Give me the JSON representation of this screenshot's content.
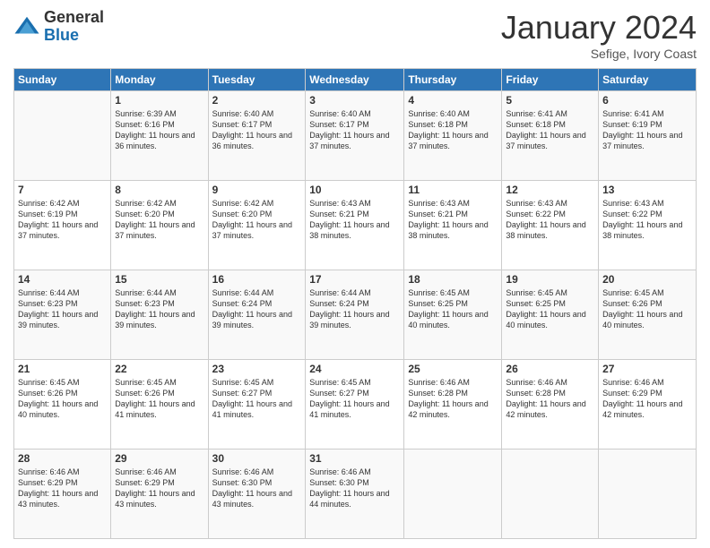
{
  "header": {
    "logo_general": "General",
    "logo_blue": "Blue",
    "month_title": "January 2024",
    "subtitle": "Sefige, Ivory Coast"
  },
  "columns": [
    "Sunday",
    "Monday",
    "Tuesday",
    "Wednesday",
    "Thursday",
    "Friday",
    "Saturday"
  ],
  "weeks": [
    [
      {
        "day": "",
        "sunrise": "",
        "sunset": "",
        "daylight": ""
      },
      {
        "day": "1",
        "sunrise": "Sunrise: 6:39 AM",
        "sunset": "Sunset: 6:16 PM",
        "daylight": "Daylight: 11 hours and 36 minutes."
      },
      {
        "day": "2",
        "sunrise": "Sunrise: 6:40 AM",
        "sunset": "Sunset: 6:17 PM",
        "daylight": "Daylight: 11 hours and 36 minutes."
      },
      {
        "day": "3",
        "sunrise": "Sunrise: 6:40 AM",
        "sunset": "Sunset: 6:17 PM",
        "daylight": "Daylight: 11 hours and 37 minutes."
      },
      {
        "day": "4",
        "sunrise": "Sunrise: 6:40 AM",
        "sunset": "Sunset: 6:18 PM",
        "daylight": "Daylight: 11 hours and 37 minutes."
      },
      {
        "day": "5",
        "sunrise": "Sunrise: 6:41 AM",
        "sunset": "Sunset: 6:18 PM",
        "daylight": "Daylight: 11 hours and 37 minutes."
      },
      {
        "day": "6",
        "sunrise": "Sunrise: 6:41 AM",
        "sunset": "Sunset: 6:19 PM",
        "daylight": "Daylight: 11 hours and 37 minutes."
      }
    ],
    [
      {
        "day": "7",
        "sunrise": "Sunrise: 6:42 AM",
        "sunset": "Sunset: 6:19 PM",
        "daylight": "Daylight: 11 hours and 37 minutes."
      },
      {
        "day": "8",
        "sunrise": "Sunrise: 6:42 AM",
        "sunset": "Sunset: 6:20 PM",
        "daylight": "Daylight: 11 hours and 37 minutes."
      },
      {
        "day": "9",
        "sunrise": "Sunrise: 6:42 AM",
        "sunset": "Sunset: 6:20 PM",
        "daylight": "Daylight: 11 hours and 37 minutes."
      },
      {
        "day": "10",
        "sunrise": "Sunrise: 6:43 AM",
        "sunset": "Sunset: 6:21 PM",
        "daylight": "Daylight: 11 hours and 38 minutes."
      },
      {
        "day": "11",
        "sunrise": "Sunrise: 6:43 AM",
        "sunset": "Sunset: 6:21 PM",
        "daylight": "Daylight: 11 hours and 38 minutes."
      },
      {
        "day": "12",
        "sunrise": "Sunrise: 6:43 AM",
        "sunset": "Sunset: 6:22 PM",
        "daylight": "Daylight: 11 hours and 38 minutes."
      },
      {
        "day": "13",
        "sunrise": "Sunrise: 6:43 AM",
        "sunset": "Sunset: 6:22 PM",
        "daylight": "Daylight: 11 hours and 38 minutes."
      }
    ],
    [
      {
        "day": "14",
        "sunrise": "Sunrise: 6:44 AM",
        "sunset": "Sunset: 6:23 PM",
        "daylight": "Daylight: 11 hours and 39 minutes."
      },
      {
        "day": "15",
        "sunrise": "Sunrise: 6:44 AM",
        "sunset": "Sunset: 6:23 PM",
        "daylight": "Daylight: 11 hours and 39 minutes."
      },
      {
        "day": "16",
        "sunrise": "Sunrise: 6:44 AM",
        "sunset": "Sunset: 6:24 PM",
        "daylight": "Daylight: 11 hours and 39 minutes."
      },
      {
        "day": "17",
        "sunrise": "Sunrise: 6:44 AM",
        "sunset": "Sunset: 6:24 PM",
        "daylight": "Daylight: 11 hours and 39 minutes."
      },
      {
        "day": "18",
        "sunrise": "Sunrise: 6:45 AM",
        "sunset": "Sunset: 6:25 PM",
        "daylight": "Daylight: 11 hours and 40 minutes."
      },
      {
        "day": "19",
        "sunrise": "Sunrise: 6:45 AM",
        "sunset": "Sunset: 6:25 PM",
        "daylight": "Daylight: 11 hours and 40 minutes."
      },
      {
        "day": "20",
        "sunrise": "Sunrise: 6:45 AM",
        "sunset": "Sunset: 6:26 PM",
        "daylight": "Daylight: 11 hours and 40 minutes."
      }
    ],
    [
      {
        "day": "21",
        "sunrise": "Sunrise: 6:45 AM",
        "sunset": "Sunset: 6:26 PM",
        "daylight": "Daylight: 11 hours and 40 minutes."
      },
      {
        "day": "22",
        "sunrise": "Sunrise: 6:45 AM",
        "sunset": "Sunset: 6:26 PM",
        "daylight": "Daylight: 11 hours and 41 minutes."
      },
      {
        "day": "23",
        "sunrise": "Sunrise: 6:45 AM",
        "sunset": "Sunset: 6:27 PM",
        "daylight": "Daylight: 11 hours and 41 minutes."
      },
      {
        "day": "24",
        "sunrise": "Sunrise: 6:45 AM",
        "sunset": "Sunset: 6:27 PM",
        "daylight": "Daylight: 11 hours and 41 minutes."
      },
      {
        "day": "25",
        "sunrise": "Sunrise: 6:46 AM",
        "sunset": "Sunset: 6:28 PM",
        "daylight": "Daylight: 11 hours and 42 minutes."
      },
      {
        "day": "26",
        "sunrise": "Sunrise: 6:46 AM",
        "sunset": "Sunset: 6:28 PM",
        "daylight": "Daylight: 11 hours and 42 minutes."
      },
      {
        "day": "27",
        "sunrise": "Sunrise: 6:46 AM",
        "sunset": "Sunset: 6:29 PM",
        "daylight": "Daylight: 11 hours and 42 minutes."
      }
    ],
    [
      {
        "day": "28",
        "sunrise": "Sunrise: 6:46 AM",
        "sunset": "Sunset: 6:29 PM",
        "daylight": "Daylight: 11 hours and 43 minutes."
      },
      {
        "day": "29",
        "sunrise": "Sunrise: 6:46 AM",
        "sunset": "Sunset: 6:29 PM",
        "daylight": "Daylight: 11 hours and 43 minutes."
      },
      {
        "day": "30",
        "sunrise": "Sunrise: 6:46 AM",
        "sunset": "Sunset: 6:30 PM",
        "daylight": "Daylight: 11 hours and 43 minutes."
      },
      {
        "day": "31",
        "sunrise": "Sunrise: 6:46 AM",
        "sunset": "Sunset: 6:30 PM",
        "daylight": "Daylight: 11 hours and 44 minutes."
      },
      {
        "day": "",
        "sunrise": "",
        "sunset": "",
        "daylight": ""
      },
      {
        "day": "",
        "sunrise": "",
        "sunset": "",
        "daylight": ""
      },
      {
        "day": "",
        "sunrise": "",
        "sunset": "",
        "daylight": ""
      }
    ]
  ]
}
